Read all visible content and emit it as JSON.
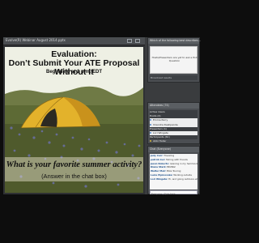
{
  "window": {
    "title": "Evolve(R) Webinar August 2014.pptx"
  },
  "slide": {
    "title_line1": "Evaluation:",
    "title_line2": "Don’t Submit Your ATE Proposal Without It",
    "subtitle": "Beginning at 1 p.m. EDT",
    "question": "What is your favorite summer activity?",
    "instruction": "(Answer in the chat box)"
  },
  "poll": {
    "header": "Which of the following best describes...",
    "body_text": "Hosts/Presenters are yet to ask a Poll Question",
    "footer": "Broadcast results"
  },
  "attendees": {
    "header": "Attendees (74)",
    "rows": [
      {
        "label": "Active Users",
        "type": "group"
      },
      {
        "label": "Hosts (2)",
        "type": "group"
      },
      {
        "label": "Emma Perry",
        "type": "highlight"
      },
      {
        "label": "Virendra Deshpande",
        "type": "highlight"
      },
      {
        "label": "Presenters (1)",
        "type": "group"
      },
      {
        "label": "Lori Wingate",
        "type": "highlight"
      },
      {
        "label": "Participants (61)",
        "type": "group"
      },
      {
        "label": "Abbi Haller",
        "type": "normal"
      }
    ]
  },
  "chat": {
    "header": "Chat (Everyone)",
    "messages": [
      {
        "name": "Judy Carr:",
        "text": "Traveling"
      },
      {
        "name": "patrick ker:",
        "text": "fishing with friends"
      },
      {
        "name": "Jason Roberts:",
        "text": "relaxing in my hammock with a good book"
      },
      {
        "name": "Diana Stark:",
        "text": "BIKING!"
      },
      {
        "name": "Walter Mair:",
        "text": "Bike Touring"
      },
      {
        "name": "Lucie Pipinovska:",
        "text": "Working outside"
      },
      {
        "name": "Lori Wingate:",
        "text": "Hi, and going outdoors when not stuck"
      }
    ],
    "input_placeholder": "Everyone | Type here"
  },
  "colors": {
    "title_band": "#eef0e4",
    "tent": "#e3b22b",
    "grass": "#5d6a35",
    "panel": "#4b4e52"
  }
}
